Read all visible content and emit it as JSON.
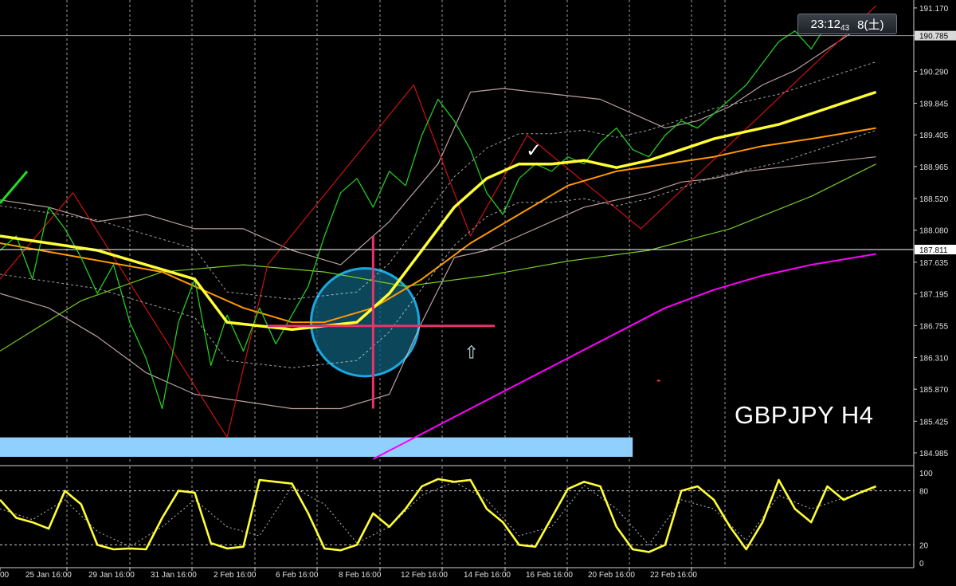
{
  "symbol_label": "GBPJPY H4",
  "clock": {
    "time": "23:12",
    "seconds": "43",
    "date": "8(土)"
  },
  "colors": {
    "background": "#000000",
    "ma_fast": "#ffff33",
    "ma_mid": "#ff9900",
    "ma_slow": "#77cc22",
    "ma_long": "#ff00ff",
    "price": "#22cc22",
    "zigzag": "#cc1111",
    "bollinger": "#e8c8c8",
    "circle_fill": "#0e5a75",
    "circle_stroke": "#1aa8e0",
    "crosshair": "#e8336a",
    "zone": "#8fd0ff"
  },
  "annotations": {
    "checkmark": "✓",
    "arrow_up": "⇧"
  },
  "chart_data": [
    {
      "type": "line",
      "name": "main",
      "yticks": [
        "191.170",
        "190.785",
        "190.290",
        "189.845",
        "189.405",
        "188.965",
        "188.520",
        "188.080",
        "187.635",
        "187.195",
        "186.755",
        "186.310",
        "185.870",
        "185.425",
        "184.985"
      ],
      "ylim": [
        184.83,
        191.28
      ],
      "hlines": [
        {
          "value": 190.785,
          "label": "190.785"
        },
        {
          "value": 187.811,
          "label": "187.811"
        }
      ],
      "xticks": [
        "00",
        "25 Jan 16:00",
        "29 Jan 16:00",
        "31 Jan 16:00",
        "2 Feb 16:00",
        "6 Feb 16:00",
        "8 Feb 16:00",
        "12 Feb 16:00",
        "14 Feb 16:00",
        "16 Feb 16:00",
        "20 Feb 16:00",
        "22 Feb 16:00"
      ],
      "x_range": [
        0,
        110
      ],
      "series": [
        {
          "role": "price",
          "x": [
            0,
            2,
            4,
            6,
            8,
            10,
            12,
            14,
            16,
            18,
            20,
            22,
            24,
            26,
            28,
            30,
            32,
            34,
            36,
            38,
            40,
            42,
            44,
            46,
            48,
            50,
            52,
            54,
            56,
            58,
            60,
            62,
            64,
            66,
            68,
            70,
            72,
            74,
            76,
            78,
            80,
            82,
            84,
            86,
            88,
            90,
            92,
            94,
            96,
            98,
            100,
            102,
            104,
            106
          ],
          "y": [
            187.8,
            188.0,
            187.4,
            188.4,
            188.1,
            187.7,
            187.2,
            187.6,
            186.8,
            186.3,
            185.6,
            186.8,
            187.4,
            186.2,
            186.9,
            186.4,
            187.0,
            186.5,
            186.9,
            187.3,
            188.0,
            188.6,
            188.8,
            188.4,
            188.9,
            188.7,
            189.4,
            189.9,
            189.6,
            189.2,
            188.6,
            188.3,
            188.8,
            189.0,
            188.9,
            189.1,
            189.0,
            189.3,
            189.5,
            189.2,
            189.1,
            189.4,
            189.6,
            189.5,
            189.7,
            189.9,
            190.1,
            190.4,
            190.7,
            190.85,
            190.6,
            190.95,
            190.9,
            191.0
          ]
        },
        {
          "role": "zigzag",
          "x": [
            0,
            9,
            28,
            33,
            51,
            58,
            65,
            79,
            108
          ],
          "y": [
            187.4,
            188.6,
            185.2,
            187.6,
            190.1,
            188.0,
            189.4,
            188.1,
            191.2
          ]
        },
        {
          "role": "ma_fast",
          "x": [
            0,
            6,
            12,
            18,
            24,
            28,
            32,
            36,
            40,
            44,
            48,
            52,
            56,
            60,
            64,
            68,
            72,
            76,
            80,
            84,
            88,
            92,
            96,
            100,
            104,
            108
          ],
          "y": [
            188.0,
            187.9,
            187.8,
            187.6,
            187.4,
            186.8,
            186.75,
            186.7,
            186.75,
            186.8,
            187.2,
            187.8,
            188.4,
            188.8,
            189.0,
            189.0,
            189.05,
            188.95,
            189.05,
            189.2,
            189.35,
            189.45,
            189.55,
            189.7,
            189.85,
            190.0
          ]
        },
        {
          "role": "ma_mid",
          "x": [
            0,
            10,
            20,
            30,
            36,
            40,
            46,
            52,
            58,
            64,
            70,
            76,
            82,
            88,
            94,
            100,
            108
          ],
          "y": [
            187.9,
            187.7,
            187.5,
            187.0,
            186.8,
            186.8,
            187.0,
            187.4,
            187.9,
            188.3,
            188.7,
            188.9,
            189.0,
            189.1,
            189.25,
            189.35,
            189.5
          ]
        },
        {
          "role": "ma_slow",
          "x": [
            0,
            10,
            20,
            30,
            40,
            50,
            60,
            70,
            80,
            90,
            100,
            108
          ],
          "y": [
            186.4,
            187.1,
            187.5,
            187.6,
            187.5,
            187.3,
            187.45,
            187.65,
            187.8,
            188.1,
            188.55,
            189.0
          ]
        },
        {
          "role": "ma_long",
          "x": [
            46,
            52,
            58,
            64,
            70,
            76,
            82,
            88,
            94,
            100,
            108
          ],
          "y": [
            184.9,
            185.25,
            185.6,
            185.95,
            186.3,
            186.65,
            187.0,
            187.25,
            187.45,
            187.6,
            187.75
          ]
        },
        {
          "role": "bollinger_upper",
          "x": [
            0,
            6,
            12,
            18,
            24,
            30,
            36,
            42,
            48,
            54,
            58,
            62,
            66,
            70,
            74,
            78,
            82,
            86,
            90,
            94,
            98,
            102,
            106,
            108
          ],
          "y": [
            188.5,
            188.4,
            188.2,
            188.3,
            188.1,
            188.1,
            187.8,
            187.6,
            188.2,
            189.0,
            190.0,
            190.05,
            190.0,
            189.95,
            189.9,
            189.7,
            189.5,
            189.6,
            189.8,
            190.1,
            190.3,
            190.6,
            190.9,
            191.05
          ]
        },
        {
          "role": "bollinger_lower",
          "x": [
            0,
            6,
            12,
            18,
            24,
            30,
            36,
            42,
            48,
            52,
            56,
            60,
            64,
            68,
            72,
            76,
            80,
            84,
            88,
            92,
            96,
            100,
            104,
            108
          ],
          "y": [
            187.2,
            187.0,
            186.6,
            186.1,
            185.8,
            185.7,
            185.6,
            185.6,
            185.8,
            186.8,
            187.7,
            187.8,
            188.0,
            188.2,
            188.4,
            188.5,
            188.6,
            188.75,
            188.8,
            188.9,
            188.95,
            189.0,
            189.05,
            189.1
          ]
        }
      ],
      "arrow": {
        "x": 58,
        "y": 186.3
      },
      "dot": {
        "x": 81,
        "y": 186.0
      },
      "zone": {
        "x0": 0,
        "x1": 78,
        "y0": 184.93,
        "y1": 185.2
      },
      "circle": {
        "x": 45,
        "y": 186.8,
        "radius_y": 0.75
      },
      "crosshair": {
        "x": 46,
        "y": 186.75,
        "x_span": [
          33,
          61
        ],
        "y_span": [
          185.6,
          188.0
        ]
      },
      "legend": "none"
    },
    {
      "type": "line",
      "name": "stochastic",
      "yticks": [
        "100",
        "80",
        "20",
        "0"
      ],
      "ylim": [
        0,
        100
      ],
      "hlines": [
        80,
        20
      ],
      "x_range": [
        0,
        110
      ],
      "series": [
        {
          "role": "main",
          "x": [
            0,
            2,
            4,
            6,
            8,
            10,
            12,
            14,
            16,
            18,
            20,
            22,
            24,
            26,
            28,
            30,
            32,
            34,
            36,
            38,
            40,
            42,
            44,
            46,
            48,
            50,
            52,
            54,
            56,
            58,
            60,
            62,
            64,
            66,
            68,
            70,
            72,
            74,
            76,
            78,
            80,
            82,
            84,
            86,
            88,
            90,
            92,
            94,
            96,
            98,
            100,
            102,
            104,
            106,
            108
          ],
          "y": [
            70,
            50,
            45,
            38,
            80,
            65,
            20,
            15,
            16,
            15,
            50,
            80,
            78,
            22,
            16,
            18,
            92,
            90,
            88,
            55,
            16,
            14,
            20,
            55,
            40,
            60,
            85,
            93,
            90,
            92,
            60,
            45,
            20,
            18,
            50,
            82,
            90,
            85,
            40,
            15,
            12,
            20,
            80,
            85,
            70,
            40,
            15,
            45,
            92,
            60,
            45,
            85,
            70,
            78,
            85
          ]
        },
        {
          "role": "signal",
          "x": [
            0,
            4,
            8,
            12,
            16,
            20,
            24,
            28,
            32,
            36,
            40,
            44,
            48,
            52,
            56,
            60,
            64,
            68,
            72,
            76,
            80,
            84,
            88,
            92,
            96,
            100,
            104,
            108
          ],
          "y": [
            60,
            48,
            70,
            35,
            18,
            40,
            70,
            40,
            30,
            85,
            65,
            22,
            40,
            75,
            90,
            70,
            30,
            40,
            86,
            60,
            20,
            70,
            60,
            25,
            75,
            60,
            72,
            82
          ]
        }
      ]
    }
  ]
}
